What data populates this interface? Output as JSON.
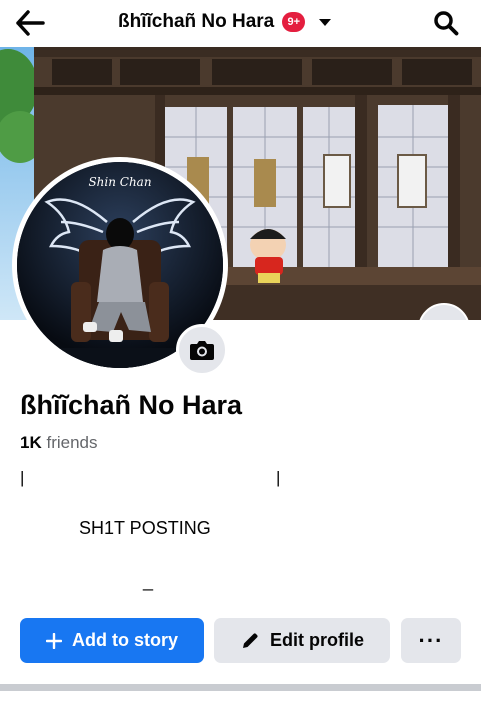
{
  "header": {
    "title": "ßhĩĩchañ No Hara",
    "notification_badge": "9+"
  },
  "profile": {
    "name": "ßhĩĩchañ No Hara",
    "friends_count": "1K",
    "friends_label": "friends",
    "avatar_caption": "Shin Chan"
  },
  "bio": {
    "line_left": "|",
    "line_right": "|",
    "text": "SH1T POSTING",
    "dash": "_"
  },
  "actions": {
    "add_story_label": "Add to story",
    "edit_profile_label": "Edit profile",
    "more_label": "···"
  },
  "colors": {
    "accent": "#1877f2",
    "badge": "#e41e3f",
    "secondary_button": "#e4e6eb"
  },
  "icons": {
    "back": "arrow-left-icon",
    "search": "search-icon",
    "camera": "camera-icon",
    "plus": "plus-icon",
    "pencil": "pencil-icon",
    "caret": "caret-down-icon"
  }
}
